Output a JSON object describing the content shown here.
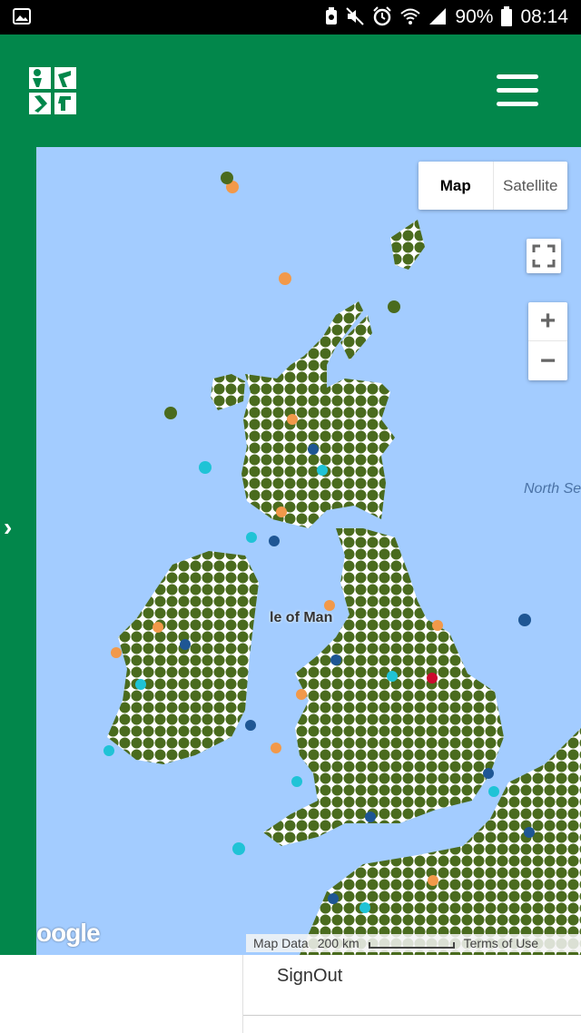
{
  "status_bar": {
    "battery": "90%",
    "time": "08:14",
    "icons": [
      "gallery-icon",
      "battery-saver-icon",
      "mute-icon",
      "alarm-icon",
      "wifi-icon",
      "signal-icon",
      "battery-icon"
    ]
  },
  "header": {
    "logo": "geocaching-logo",
    "menu_icon": "hamburger-menu-icon"
  },
  "sidebar": {
    "toggle_icon": "chevron-right-icon",
    "toggle_glyph": "›"
  },
  "map": {
    "type_control": {
      "map_label": "Map",
      "satellite_label": "Satellite",
      "active": "Map"
    },
    "zoom_in_label": "+",
    "zoom_out_label": "−",
    "sea_label": "North Se",
    "city_label": "le of Man",
    "google_logo_text": "oogle",
    "footer": {
      "map_data": "Map Data",
      "scale": "200 km",
      "terms": "Terms of Use"
    },
    "marker_colors": {
      "traditional": "#4a6b1e",
      "mystery": "#1e5694",
      "multi": "#f2994a",
      "earthcache": "#1fc3d6",
      "event": "#cc0a2e"
    }
  },
  "bottom_panel": {
    "signout_label": "SignOut"
  },
  "colors": {
    "brand_green": "#02874b",
    "sea": "#a3ccff"
  }
}
